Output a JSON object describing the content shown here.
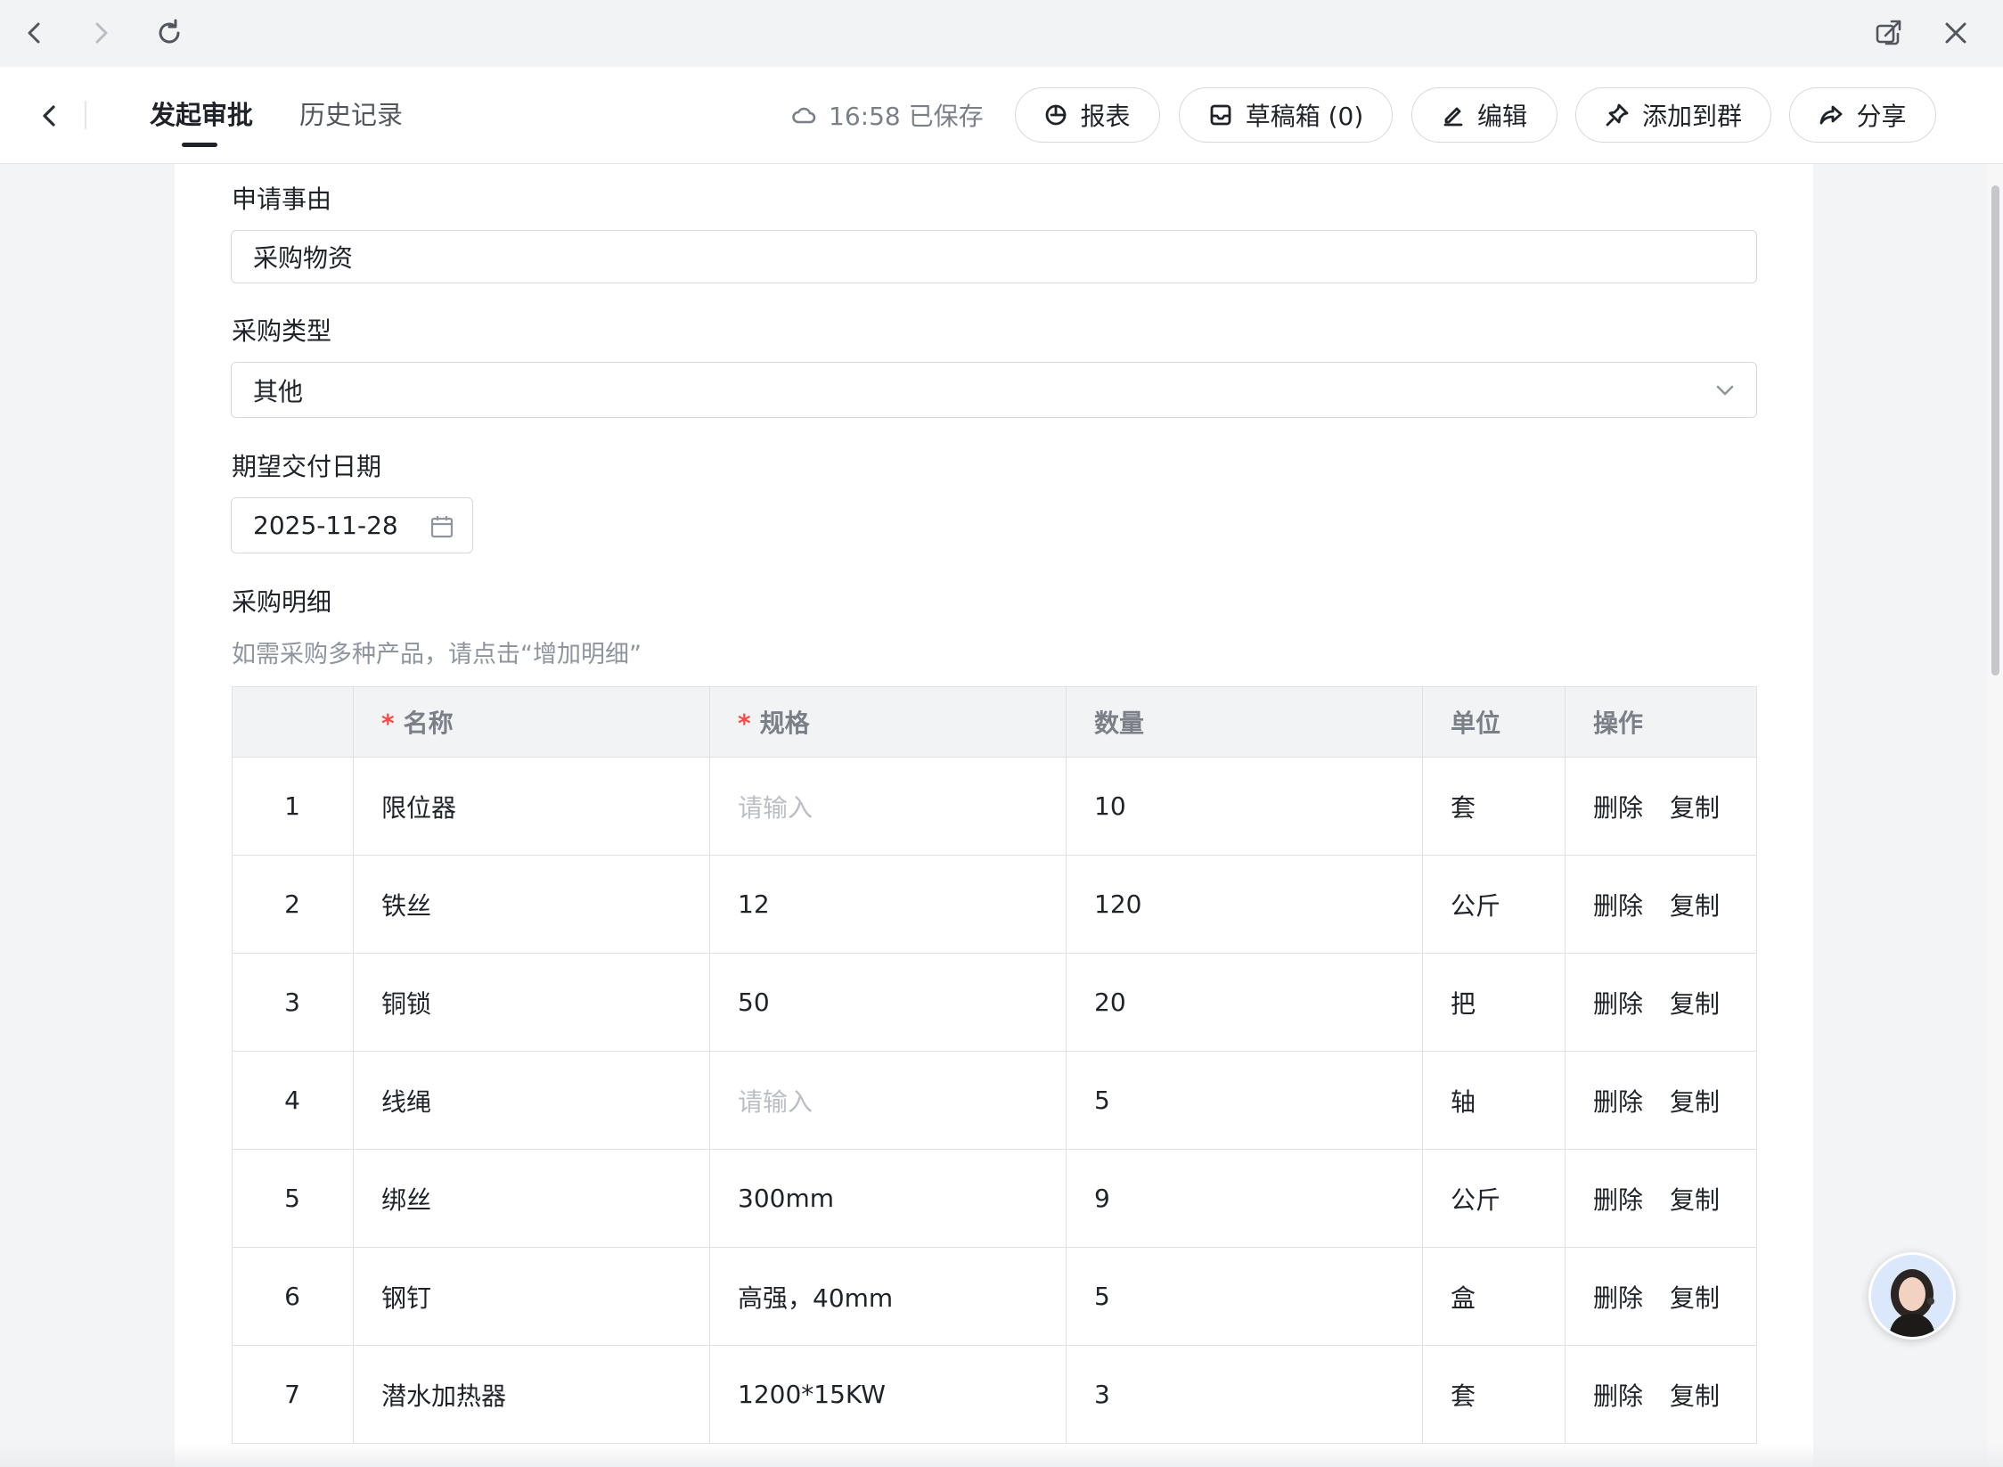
{
  "header": {
    "tabs": [
      {
        "label": "发起审批",
        "active": true
      },
      {
        "label": "历史记录",
        "active": false
      }
    ],
    "saved_status": "16:58 已保存",
    "buttons": {
      "report": "报表",
      "drafts": "草稿箱 (0)",
      "edit": "编辑",
      "add_to_group": "添加到群",
      "share": "分享"
    }
  },
  "form": {
    "reason": {
      "label": "申请事由",
      "value": "采购物资"
    },
    "purchase_type": {
      "label": "采购类型",
      "value": "其他"
    },
    "delivery_date": {
      "label": "期望交付日期",
      "value": "2025-11-28"
    },
    "details": {
      "label": "采购明细",
      "hint": "如需采购多种产品，请点击“增加明细”",
      "columns": {
        "name": "名称",
        "spec": "规格",
        "qty": "数量",
        "unit": "单位",
        "ops": "操作"
      },
      "placeholder": "请输入",
      "actions": {
        "delete": "删除",
        "copy": "复制"
      },
      "rows": [
        {
          "idx": "1",
          "name": "限位器",
          "spec": "",
          "qty": "10",
          "unit": "套"
        },
        {
          "idx": "2",
          "name": "铁丝",
          "spec": "12",
          "qty": "120",
          "unit": "公斤"
        },
        {
          "idx": "3",
          "name": "铜锁",
          "spec": "50",
          "qty": "20",
          "unit": "把"
        },
        {
          "idx": "4",
          "name": "线绳",
          "spec": "",
          "qty": "5",
          "unit": "轴"
        },
        {
          "idx": "5",
          "name": "绑丝",
          "spec": "300mm",
          "qty": "9",
          "unit": "公斤"
        },
        {
          "idx": "6",
          "name": "钢钉",
          "spec": "高强，40mm",
          "qty": "5",
          "unit": "盒"
        },
        {
          "idx": "7",
          "name": "潜水加热器",
          "spec": "1200*15KW",
          "qty": "3",
          "unit": "套"
        }
      ]
    }
  },
  "colors": {
    "required_star": "#f54a45",
    "placeholder": "#bbbfc4",
    "hint": "#8f959e"
  }
}
